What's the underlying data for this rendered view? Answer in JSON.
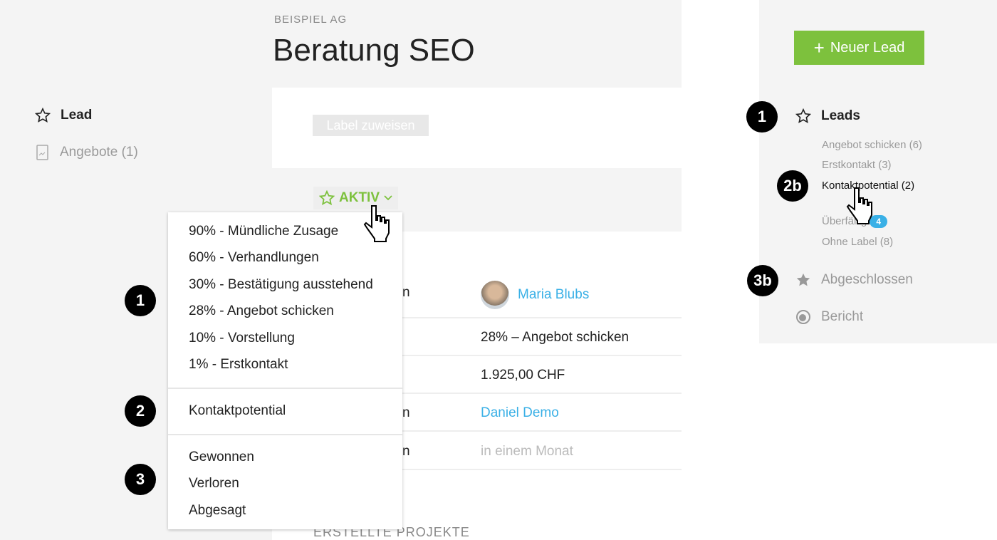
{
  "header": {
    "company": "BEISPIEL AG",
    "title": "Beratung SEO"
  },
  "left_nav": [
    {
      "label": "Lead",
      "icon": "star-outline-icon"
    },
    {
      "label": "Angebote (1)",
      "icon": "document-icon"
    }
  ],
  "label_button": "Label zuweisen",
  "status_button": {
    "label": "AKTIV",
    "color": "#7dc13d"
  },
  "details": [
    {
      "label_fragment": "n",
      "value": "Maria Blubs",
      "link": true
    },
    {
      "label_fragment": "",
      "value": "28% – Angebot schicken"
    },
    {
      "label_fragment": "",
      "value": "1.925,00 CHF"
    },
    {
      "label_fragment": "n",
      "value": "Daniel Demo",
      "link": true
    },
    {
      "label_fragment": "n",
      "value": "in einem Monat",
      "muted": true
    }
  ],
  "dropdown": {
    "group1": [
      "90% - Mündliche Zusage",
      "60% - Verhandlungen",
      "30% - Bestätigung ausstehend",
      "28% - Angebot schicken",
      "10% - Vorstellung",
      "1% - Erstkontakt"
    ],
    "group2": [
      "Kontaktpotential"
    ],
    "group3": [
      "Gewonnen",
      "Verloren",
      "Abgesagt"
    ]
  },
  "annotations": {
    "a1": "1",
    "a2": "2",
    "a3": "3",
    "r1": "1",
    "r2b": "2b",
    "r3b": "3b"
  },
  "section_title": "ERSTELLTE PROJEKTE",
  "right_nav": {
    "new_lead": "Neuer Lead",
    "leads": "Leads",
    "sub": [
      "Angebot schicken (6)",
      "Erstkontakt (3)",
      "Kontaktpotential (2)"
    ],
    "overdue": "Überfällig",
    "overdue_count": "4",
    "no_label": "Ohne Label (8)",
    "closed": "Abgeschlossen",
    "report": "Bericht"
  },
  "colors": {
    "accent": "#7dc13d",
    "link": "#3ab0e6",
    "badge": "#3ab0e6"
  }
}
